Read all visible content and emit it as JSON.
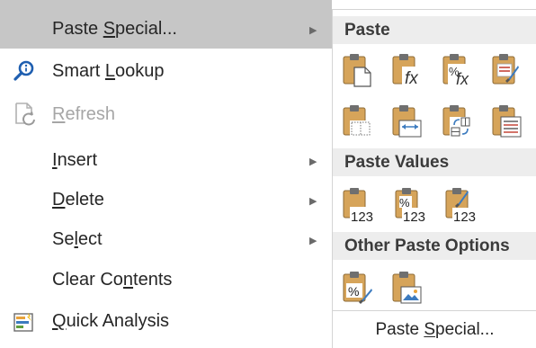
{
  "context_menu": {
    "items": [
      {
        "pre": "Paste ",
        "key": "S",
        "post": "pecial...",
        "has_arrow": true,
        "highlighted": true,
        "disabled": false,
        "icon": "none"
      },
      {
        "pre": "Smart ",
        "key": "L",
        "post": "ookup",
        "has_arrow": false,
        "highlighted": false,
        "disabled": false,
        "icon": "search-icon"
      },
      {
        "pre": "",
        "key": "R",
        "post": "efresh",
        "has_arrow": false,
        "highlighted": false,
        "disabled": true,
        "icon": "refresh-icon"
      },
      {
        "pre": "",
        "key": "I",
        "post": "nsert",
        "has_arrow": true,
        "highlighted": false,
        "disabled": false,
        "icon": "none"
      },
      {
        "pre": "",
        "key": "D",
        "post": "elete",
        "has_arrow": true,
        "highlighted": false,
        "disabled": false,
        "icon": "none"
      },
      {
        "pre": "Se",
        "key": "l",
        "post": "ect",
        "has_arrow": true,
        "highlighted": false,
        "disabled": false,
        "icon": "none"
      },
      {
        "pre": "Clear Co",
        "key": "n",
        "post": "tents",
        "has_arrow": false,
        "highlighted": false,
        "disabled": false,
        "icon": "none"
      },
      {
        "pre": "",
        "key": "Q",
        "post": "uick Analysis",
        "has_arrow": false,
        "highlighted": false,
        "disabled": false,
        "icon": "quick-analysis-icon"
      }
    ],
    "arrow_glyph": "▶"
  },
  "submenu": {
    "sections": {
      "paste": "Paste",
      "paste_values": "Paste Values",
      "other": "Other Paste Options"
    },
    "paste_icons": [
      "paste-icon",
      "paste-formulas-icon",
      "paste-formulas-number-formatting-icon",
      "keep-source-formatting-icon",
      "no-borders-icon",
      "keep-column-widths-icon",
      "transpose-icon",
      "paste-link-formatting-icon"
    ],
    "values_icons": [
      "paste-values-icon",
      "values-number-formatting-icon",
      "values-source-formatting-icon"
    ],
    "other_icons": [
      "paste-formatting-icon",
      "paste-picture-icon"
    ],
    "glyphs": {
      "fx": "fx",
      "percent": "%",
      "values": "123"
    },
    "paste_special": {
      "pre": "Paste ",
      "key": "S",
      "post": "pecial..."
    }
  },
  "colors": {
    "highlight_row": "#c6c6c6",
    "clipboard": "#d6a45a",
    "clipboard_dark": "#8c6a35",
    "annotation": "#f5ff00",
    "search_icon": "#1f5fb0"
  }
}
